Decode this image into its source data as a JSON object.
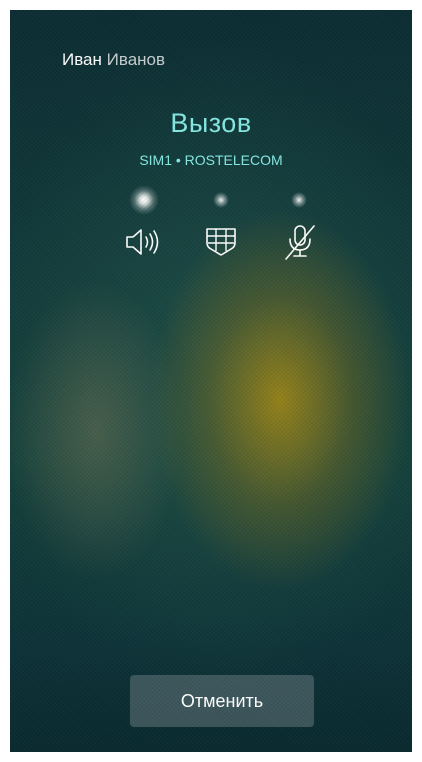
{
  "contact": {
    "first_name": "Иван",
    "last_name": "Иванов"
  },
  "call": {
    "status": "Вызов",
    "sim_info": "SIM1 • ROSTELECOM"
  },
  "actions": [
    {
      "icon": "speaker-icon",
      "active": true
    },
    {
      "icon": "keypad-icon",
      "active": false
    },
    {
      "icon": "mic-muted-icon",
      "active": false
    }
  ],
  "buttons": {
    "cancel_label": "Отменить"
  },
  "colors": {
    "accent": "#86e9e3",
    "text": "#ffffff",
    "button_bg": "#5f7075"
  }
}
